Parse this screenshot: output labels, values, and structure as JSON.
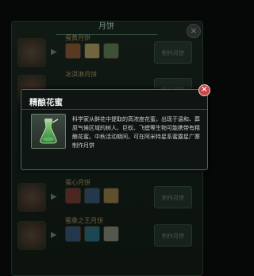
{
  "background_list": {
    "title": "月饼",
    "close_label": "×",
    "rows": [
      {
        "name": "蛋黄月饼",
        "button": "制作月饼"
      },
      {
        "name": "冰淇淋月饼",
        "button": "制作月饼"
      },
      {
        "name": "",
        "button": ""
      },
      {
        "name": "",
        "button": ""
      },
      {
        "name": "蛋心月饼",
        "button": "制作月饼"
      },
      {
        "name": "蜜桑之王月饼",
        "button": "制作月饼"
      }
    ]
  },
  "popup": {
    "title": "精酿花蜜",
    "close_label": "×",
    "item_icon": "honey-bottle-icon",
    "description": "科学家从鲜花中提取的高浓度花蜜，出现于温和、葬原气候区域的树人、巨蚁、飞螳等生物可能携带有精酿花蜜。中秋活动期间，可在阿米特星系蜜露星广寨制作月饼"
  },
  "colors": {
    "popup_bg": "#0f1512",
    "close_red": "#c84646",
    "accent_green": "#3e6a55"
  }
}
